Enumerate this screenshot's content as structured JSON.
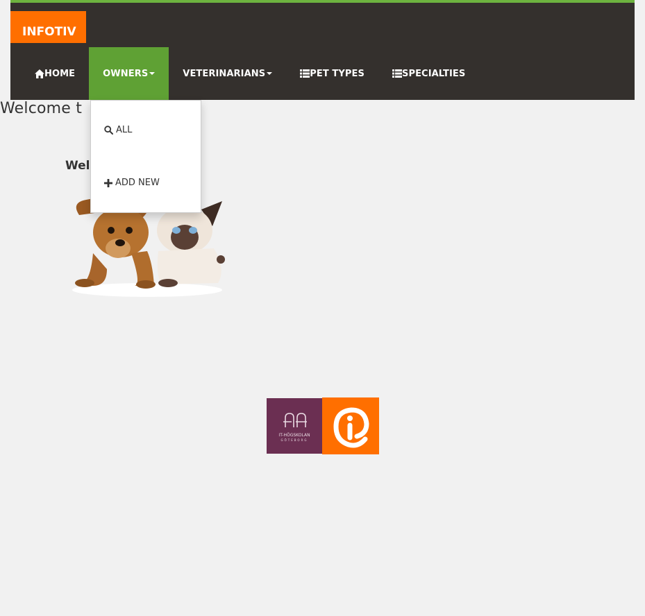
{
  "brand": {
    "name": "INFOTIV"
  },
  "nav": {
    "items": [
      {
        "label": "HOME",
        "icon": "home-icon"
      },
      {
        "label": "OWNERS",
        "icon": "caret-down-icon",
        "active": true
      },
      {
        "label": "VETERINARIANS",
        "icon": "caret-down-icon"
      },
      {
        "label": "PET TYPES",
        "icon": "list-icon"
      },
      {
        "label": "SPECIALTIES",
        "icon": "list-icon"
      }
    ]
  },
  "owners_dropdown": {
    "items": [
      {
        "label": "ALL",
        "icon": "search-icon"
      },
      {
        "label": "ADD NEW",
        "icon": "plus-icon"
      }
    ]
  },
  "page": {
    "title": "Welcome t",
    "welcome_text": "Welc"
  },
  "footer_logos": {
    "ith": {
      "line1": "IT-HÖGSKOLAN",
      "line2": "GÖTEBORG"
    }
  },
  "colors": {
    "accent_green": "#6db33f",
    "active_green": "#5fa134",
    "navbar_bg": "#34302d",
    "brand_orange": "#ff6f00",
    "ith_purple": "#6b2f52",
    "page_bg": "#f1f1f1"
  }
}
